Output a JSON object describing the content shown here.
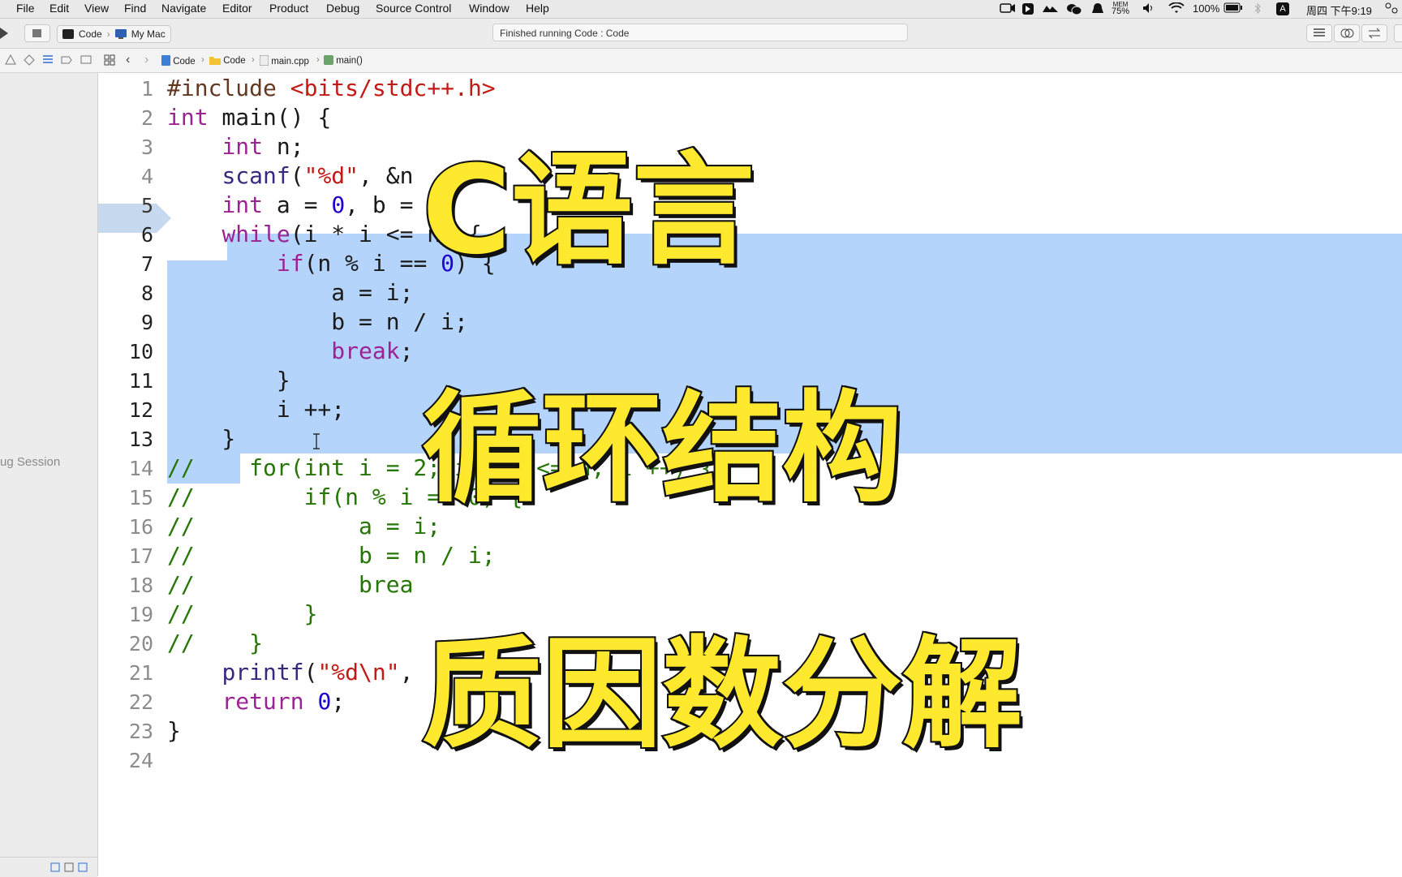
{
  "menubar": {
    "items": [
      "File",
      "Edit",
      "View",
      "Find",
      "Navigate",
      "Editor",
      "Product",
      "Debug",
      "Source Control",
      "Window",
      "Help"
    ],
    "mem_label": "MEM",
    "mem_value": "75%",
    "battery": "100%",
    "input_method": "A",
    "datetime": "周四 下午9:19"
  },
  "toolbar": {
    "scheme": "Code",
    "destination": "My Mac",
    "activity": "Finished running Code : Code"
  },
  "jumpbar": {
    "crumbs": [
      "Code",
      "Code",
      "main.cpp",
      "main()"
    ]
  },
  "sidebar": {
    "debug_session_label": "ug Session"
  },
  "editor": {
    "current_line": 5,
    "line_numbers": [
      "1",
      "2",
      "3",
      "4",
      "5",
      "6",
      "7",
      "8",
      "9",
      "10",
      "11",
      "12",
      "13",
      "14",
      "15",
      "16",
      "17",
      "18",
      "19",
      "20",
      "21",
      "22",
      "23",
      "24"
    ],
    "lines": [
      "#include <bits/stdc++.h>",
      "int main() {",
      "    int n;",
      "    scanf(\"%d\", &n",
      "    int a = 0, b =",
      "    while(i * i <= n) {",
      "        if(n % i == 0) {",
      "            a = i;",
      "            b = n / i;",
      "            break;",
      "        }",
      "        i ++;",
      "    }",
      "//    for(int i = 2; i * i <= n; i ++) {",
      "//        if(n % i == 0) {",
      "//            a = i;",
      "//            b = n / i;",
      "//            brea",
      "//        }",
      "//    }",
      "    printf(\"%d\\n\", ",
      "    return 0;",
      "}",
      ""
    ]
  },
  "overlay": {
    "line1": "C语言",
    "line2": "循环结构",
    "line3": "质因数分解"
  },
  "colors": {
    "overlay_fill": "#ffe92e",
    "selection": "#b4d4fb",
    "keyword": "#9b2393",
    "comment": "#267507"
  }
}
